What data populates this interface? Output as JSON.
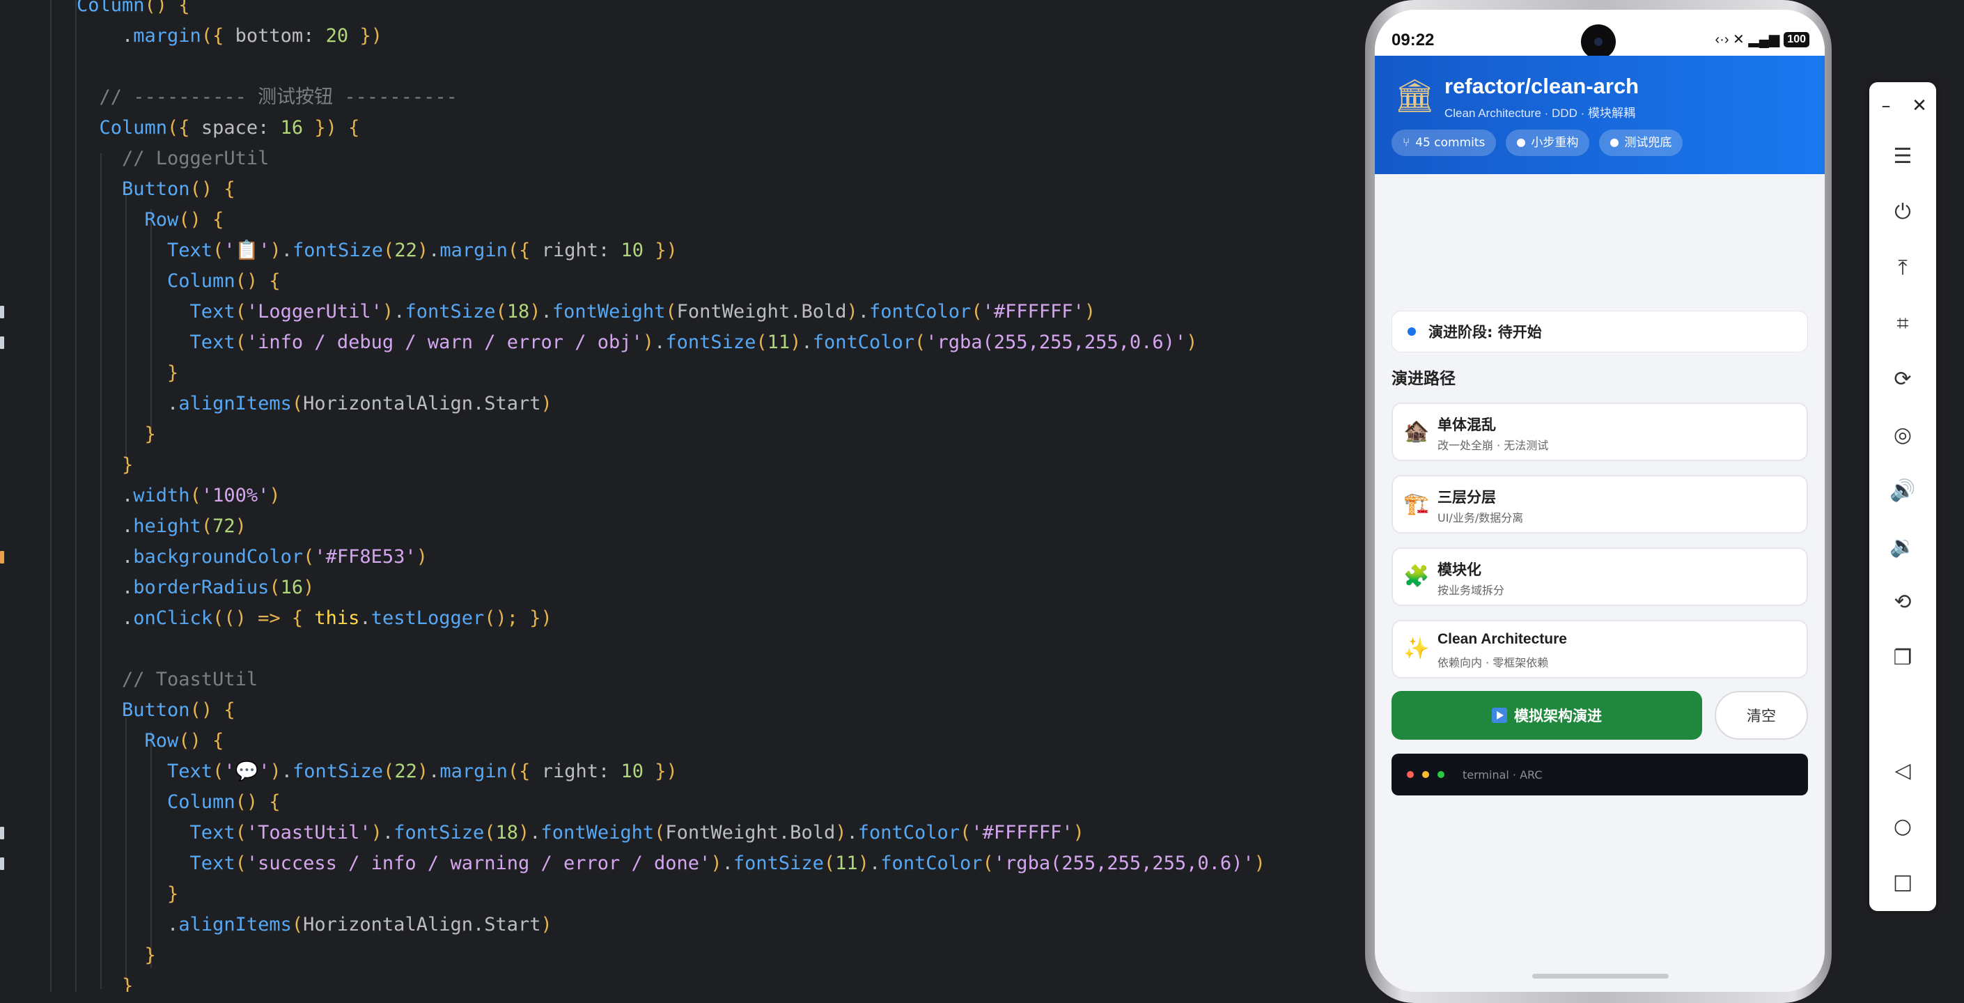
{
  "editor": {
    "lines": [
      [
        [
          "Column",
          "t-f"
        ],
        [
          "() {",
          "t-o"
        ]
      ],
      [
        [
          "    .",
          "t-p"
        ],
        [
          "margin",
          "t-m"
        ],
        [
          "({ ",
          "t-o"
        ],
        [
          "bottom",
          "t-p"
        ],
        [
          ": ",
          "t-p"
        ],
        [
          "20",
          "t-g"
        ],
        [
          " })",
          "t-o"
        ]
      ],
      [
        [
          "",
          "t-p"
        ]
      ],
      [
        [
          "  // ---------- 测试按钮 ----------",
          "t-c"
        ]
      ],
      [
        [
          "  Column",
          "t-f"
        ],
        [
          "({ ",
          "t-o"
        ],
        [
          "space",
          "t-p"
        ],
        [
          ": ",
          "t-p"
        ],
        [
          "16",
          "t-g"
        ],
        [
          " }) {",
          "t-o"
        ]
      ],
      [
        [
          "    // LoggerUtil",
          "t-c"
        ]
      ],
      [
        [
          "    Button",
          "t-f"
        ],
        [
          "() {",
          "t-o"
        ]
      ],
      [
        [
          "      Row",
          "t-f"
        ],
        [
          "() {",
          "t-o"
        ]
      ],
      [
        [
          "        Text",
          "t-f"
        ],
        [
          "(",
          "t-o"
        ],
        [
          "'📋'",
          "t-pk"
        ],
        [
          ")",
          "t-o"
        ],
        [
          ".",
          "t-p"
        ],
        [
          "fontSize",
          "t-m"
        ],
        [
          "(",
          "t-o"
        ],
        [
          "22",
          "t-g"
        ],
        [
          ")",
          "t-o"
        ],
        [
          ".",
          "t-p"
        ],
        [
          "margin",
          "t-m"
        ],
        [
          "({ ",
          "t-o"
        ],
        [
          "right",
          "t-p"
        ],
        [
          ": ",
          "t-p"
        ],
        [
          "10",
          "t-g"
        ],
        [
          " })",
          "t-o"
        ]
      ],
      [
        [
          "        Column",
          "t-f"
        ],
        [
          "() {",
          "t-o"
        ]
      ],
      [
        [
          "          Text",
          "t-f"
        ],
        [
          "(",
          "t-o"
        ],
        [
          "'LoggerUtil'",
          "t-pk"
        ],
        [
          ")",
          "t-o"
        ],
        [
          ".",
          "t-p"
        ],
        [
          "fontSize",
          "t-m"
        ],
        [
          "(",
          "t-o"
        ],
        [
          "18",
          "t-g"
        ],
        [
          ")",
          "t-o"
        ],
        [
          ".",
          "t-p"
        ],
        [
          "fontWeight",
          "t-m"
        ],
        [
          "(",
          "t-o"
        ],
        [
          "FontWeight.Bold",
          "t-p"
        ],
        [
          ")",
          "t-o"
        ],
        [
          ".",
          "t-p"
        ],
        [
          "fontColor",
          "t-m"
        ],
        [
          "(",
          "t-o"
        ],
        [
          "'#FFFFFF'",
          "t-pk"
        ],
        [
          ")",
          "t-o"
        ]
      ],
      [
        [
          "          Text",
          "t-f"
        ],
        [
          "(",
          "t-o"
        ],
        [
          "'info / debug / warn / error / obj'",
          "t-pk"
        ],
        [
          ")",
          "t-o"
        ],
        [
          ".",
          "t-p"
        ],
        [
          "fontSize",
          "t-m"
        ],
        [
          "(",
          "t-o"
        ],
        [
          "11",
          "t-g"
        ],
        [
          ")",
          "t-o"
        ],
        [
          ".",
          "t-p"
        ],
        [
          "fontColor",
          "t-m"
        ],
        [
          "(",
          "t-o"
        ],
        [
          "'rgba(255,255,255,0.6)'",
          "t-pk"
        ],
        [
          ")",
          "t-o"
        ]
      ],
      [
        [
          "        }",
          "t-o"
        ]
      ],
      [
        [
          "        .",
          "t-p"
        ],
        [
          "alignItems",
          "t-m"
        ],
        [
          "(",
          "t-o"
        ],
        [
          "HorizontalAlign.Start",
          "t-p"
        ],
        [
          ")",
          "t-o"
        ]
      ],
      [
        [
          "      }",
          "t-o"
        ]
      ],
      [
        [
          "    }",
          "t-o"
        ]
      ],
      [
        [
          "    .",
          "t-p"
        ],
        [
          "width",
          "t-m"
        ],
        [
          "(",
          "t-o"
        ],
        [
          "'100%'",
          "t-pk"
        ],
        [
          ")",
          "t-o"
        ]
      ],
      [
        [
          "    .",
          "t-p"
        ],
        [
          "height",
          "t-m"
        ],
        [
          "(",
          "t-o"
        ],
        [
          "72",
          "t-g"
        ],
        [
          ")",
          "t-o"
        ]
      ],
      [
        [
          "    .",
          "t-p"
        ],
        [
          "backgroundColor",
          "t-m"
        ],
        [
          "(",
          "t-o"
        ],
        [
          "'#FF8E53'",
          "t-pk"
        ],
        [
          ")",
          "t-o"
        ]
      ],
      [
        [
          "    .",
          "t-p"
        ],
        [
          "borderRadius",
          "t-m"
        ],
        [
          "(",
          "t-o"
        ],
        [
          "16",
          "t-g"
        ],
        [
          ")",
          "t-o"
        ]
      ],
      [
        [
          "    .",
          "t-p"
        ],
        [
          "onClick",
          "t-m"
        ],
        [
          "(() => { ",
          "t-o"
        ],
        [
          "this",
          "t-w"
        ],
        [
          ".",
          "t-p"
        ],
        [
          "testLogger",
          "t-m"
        ],
        [
          "(); })",
          "t-o"
        ]
      ],
      [
        [
          "",
          "t-p"
        ]
      ],
      [
        [
          "    // ToastUtil",
          "t-c"
        ]
      ],
      [
        [
          "    Button",
          "t-f"
        ],
        [
          "() {",
          "t-o"
        ]
      ],
      [
        [
          "      Row",
          "t-f"
        ],
        [
          "() {",
          "t-o"
        ]
      ],
      [
        [
          "        Text",
          "t-f"
        ],
        [
          "(",
          "t-o"
        ],
        [
          "'💬'",
          "t-pk"
        ],
        [
          ")",
          "t-o"
        ],
        [
          ".",
          "t-p"
        ],
        [
          "fontSize",
          "t-m"
        ],
        [
          "(",
          "t-o"
        ],
        [
          "22",
          "t-g"
        ],
        [
          ")",
          "t-o"
        ],
        [
          ".",
          "t-p"
        ],
        [
          "margin",
          "t-m"
        ],
        [
          "({ ",
          "t-o"
        ],
        [
          "right",
          "t-p"
        ],
        [
          ": ",
          "t-p"
        ],
        [
          "10",
          "t-g"
        ],
        [
          " })",
          "t-o"
        ]
      ],
      [
        [
          "        Column",
          "t-f"
        ],
        [
          "() {",
          "t-o"
        ]
      ],
      [
        [
          "          Text",
          "t-f"
        ],
        [
          "(",
          "t-o"
        ],
        [
          "'ToastUtil'",
          "t-pk"
        ],
        [
          ")",
          "t-o"
        ],
        [
          ".",
          "t-p"
        ],
        [
          "fontSize",
          "t-m"
        ],
        [
          "(",
          "t-o"
        ],
        [
          "18",
          "t-g"
        ],
        [
          ")",
          "t-o"
        ],
        [
          ".",
          "t-p"
        ],
        [
          "fontWeight",
          "t-m"
        ],
        [
          "(",
          "t-o"
        ],
        [
          "FontWeight.Bold",
          "t-p"
        ],
        [
          ")",
          "t-o"
        ],
        [
          ".",
          "t-p"
        ],
        [
          "fontColor",
          "t-m"
        ],
        [
          "(",
          "t-o"
        ],
        [
          "'#FFFFFF'",
          "t-pk"
        ],
        [
          ")",
          "t-o"
        ]
      ],
      [
        [
          "          Text",
          "t-f"
        ],
        [
          "(",
          "t-o"
        ],
        [
          "'success / info / warning / error / done'",
          "t-pk"
        ],
        [
          ")",
          "t-o"
        ],
        [
          ".",
          "t-p"
        ],
        [
          "fontSize",
          "t-m"
        ],
        [
          "(",
          "t-o"
        ],
        [
          "11",
          "t-g"
        ],
        [
          ")",
          "t-o"
        ],
        [
          ".",
          "t-p"
        ],
        [
          "fontColor",
          "t-m"
        ],
        [
          "(",
          "t-o"
        ],
        [
          "'rgba(255,255,255,0.6)'",
          "t-pk"
        ],
        [
          ")",
          "t-o"
        ]
      ],
      [
        [
          "        }",
          "t-o"
        ]
      ],
      [
        [
          "        .",
          "t-p"
        ],
        [
          "alignItems",
          "t-m"
        ],
        [
          "(",
          "t-o"
        ],
        [
          "HorizontalAlign.Start",
          "t-p"
        ],
        [
          ")",
          "t-o"
        ]
      ],
      [
        [
          "      }",
          "t-o"
        ]
      ],
      [
        [
          "    }",
          "t-o"
        ]
      ]
    ],
    "gutter_marks": [
      {
        "line": 10,
        "color": "#c9d1d9"
      },
      {
        "line": 11,
        "color": "#c9d1d9"
      },
      {
        "line": 18,
        "color": "#e8a04a"
      },
      {
        "line": 27,
        "color": "#c9d1d9"
      },
      {
        "line": 28,
        "color": "#c9d1d9"
      }
    ]
  },
  "phone": {
    "status": {
      "time": "09:22",
      "icons": "‹·› ✕ ▂▄▆",
      "battery": "100"
    },
    "header": {
      "icon": "classical-building-icon",
      "title": "refactor/clean-arch",
      "subtitle": "Clean Architecture · DDD · 模块解耦",
      "chips": [
        {
          "label": "45 commits",
          "prefix": "⑂"
        },
        {
          "label": "小步重构",
          "prefix": "dot"
        },
        {
          "label": "测试兜底",
          "prefix": "dot"
        }
      ],
      "accent": "#1668dc"
    },
    "stage": {
      "label": "演进阶段: 待开始",
      "dot_color": "#1a73e8"
    },
    "path_title": "演进路径",
    "path_items": [
      {
        "icon": "🏚️",
        "icon_name": "derelict-house-icon",
        "title": "单体混乱",
        "subtitle": "改一处全崩 · 无法测试"
      },
      {
        "icon": "🏗️",
        "icon_name": "construction-crane-icon",
        "title": "三层分层",
        "subtitle": "UI/业务/数据分离"
      },
      {
        "icon": "🧩",
        "icon_name": "puzzle-piece-icon",
        "title": "模块化",
        "subtitle": "按业务域拆分"
      },
      {
        "icon": "✨",
        "icon_name": "sparkles-icon",
        "title": "Clean Architecture",
        "subtitle": "依赖向内 · 零框架依赖"
      }
    ],
    "actions": {
      "simulate_label": "模拟架构演进",
      "simulate_color": "#1f883d",
      "clear_label": "清空"
    },
    "terminal": {
      "label": "terminal · ARC",
      "dots": [
        "#ff5f57",
        "#febc2e",
        "#28c840"
      ]
    }
  },
  "toolbar": {
    "top": [
      {
        "name": "minimize-icon",
        "glyph": "–"
      },
      {
        "name": "close-icon",
        "glyph": "✕"
      }
    ],
    "buttons": [
      {
        "name": "menu-icon",
        "glyph": "☰"
      },
      {
        "name": "power-icon",
        "glyph": "⏻"
      },
      {
        "name": "pin-top-icon",
        "glyph": "⤒"
      },
      {
        "name": "crop-icon",
        "glyph": "⌗"
      },
      {
        "name": "rotate-icon",
        "glyph": "⟳"
      },
      {
        "name": "screenshot-icon",
        "glyph": "◎"
      },
      {
        "name": "volume-up-icon",
        "glyph": "🔊"
      },
      {
        "name": "volume-down-icon",
        "glyph": "🔉"
      },
      {
        "name": "rotate-device-icon",
        "glyph": "⟲"
      },
      {
        "name": "multi-device-icon",
        "glyph": "❐"
      },
      {
        "name": "back-icon",
        "glyph": "◁"
      },
      {
        "name": "home-icon",
        "glyph": "○"
      },
      {
        "name": "recents-icon",
        "glyph": "□"
      }
    ]
  }
}
